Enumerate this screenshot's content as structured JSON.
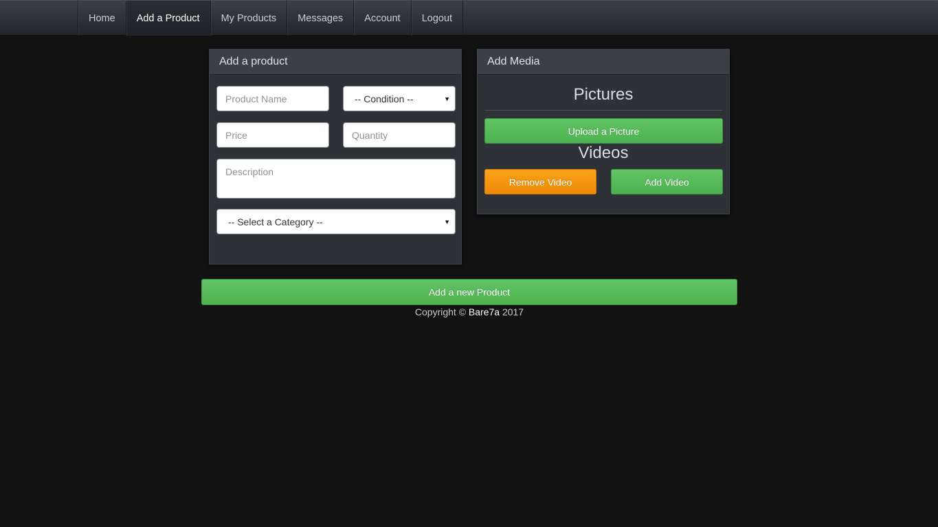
{
  "navbar": {
    "items": [
      {
        "label": "Home",
        "active": false
      },
      {
        "label": "Add a Product",
        "active": true
      },
      {
        "label": "My Products",
        "active": false
      },
      {
        "label": "Messages",
        "active": false
      },
      {
        "label": "Account",
        "active": false
      },
      {
        "label": "Logout",
        "active": false
      }
    ]
  },
  "product_panel": {
    "title": "Add a product",
    "product_name": {
      "placeholder": "Product Name",
      "value": ""
    },
    "condition": {
      "selected": "-- Condition --"
    },
    "price": {
      "placeholder": "Price",
      "value": ""
    },
    "quantity": {
      "placeholder": "Quantity",
      "value": ""
    },
    "description": {
      "placeholder": "Description",
      "value": ""
    },
    "category": {
      "selected": "-- Select a Category --"
    }
  },
  "media_panel": {
    "title": "Add Media",
    "pictures_heading": "Pictures",
    "upload_picture_label": "Upload a Picture",
    "videos_heading": "Videos",
    "remove_video_label": "Remove Video",
    "add_video_label": "Add Video"
  },
  "submit": {
    "label": "Add a new Product"
  },
  "footer": {
    "prefix": "Copyright ©",
    "brand": "Bare7a",
    "year": "2017"
  },
  "colors": {
    "background": "#121212",
    "panel": "#2e3237",
    "green": "#5cb85c",
    "orange": "#f0900a"
  }
}
